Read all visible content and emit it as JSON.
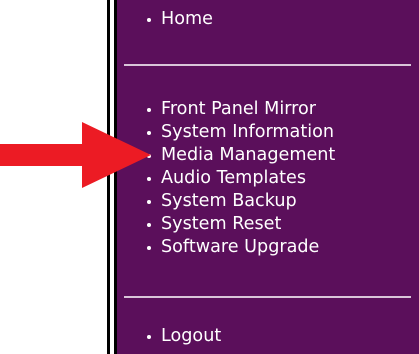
{
  "colors": {
    "panel_background": "#5b0f5b",
    "text": "#ffffff",
    "divider": "#d9c5d9",
    "arrow": "#ec1b24"
  },
  "menu": {
    "top_items": [
      {
        "label": "Home"
      }
    ],
    "middle_items": [
      {
        "label": "Front Panel Mirror"
      },
      {
        "label": "System Information"
      },
      {
        "label": "Media Management"
      },
      {
        "label": "Audio Templates"
      },
      {
        "label": "System Backup"
      },
      {
        "label": "System Reset"
      },
      {
        "label": "Software Upgrade"
      }
    ],
    "bottom_items": [
      {
        "label": "Logout"
      }
    ]
  },
  "annotation": {
    "icon": "red-arrow-icon",
    "points_to": "Media Management"
  }
}
